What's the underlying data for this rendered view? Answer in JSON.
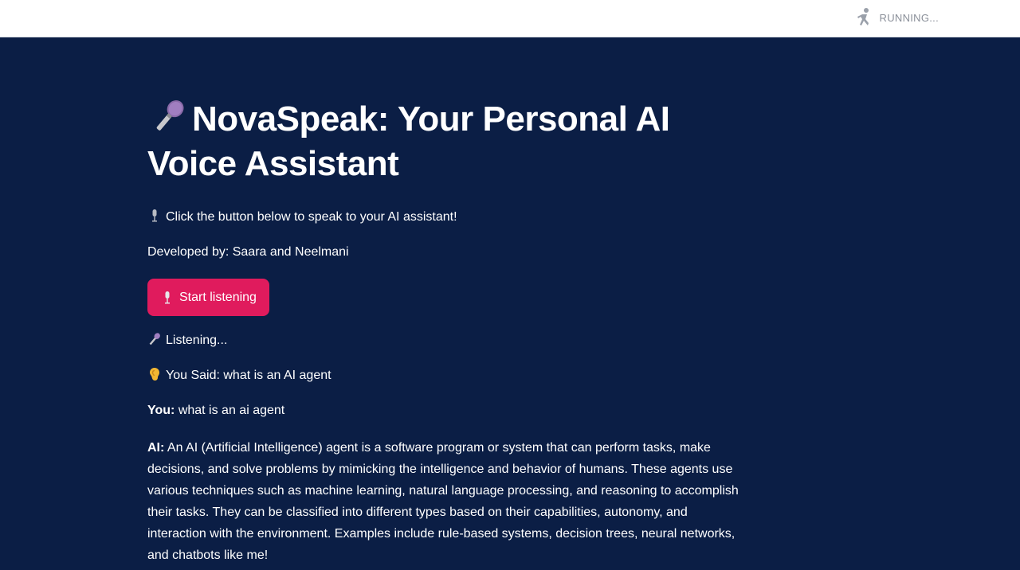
{
  "header": {
    "status_text": "RUNNING...",
    "status_icon": "running-person-icon"
  },
  "app": {
    "title_icon": "microphone-icon",
    "title": "NovaSpeak: Your Personal AI Voice Assistant",
    "instruction_icon": "studio-microphone-icon",
    "instruction": "Click the button below to speak to your AI assistant!",
    "developer": "Developed by: Saara and Neelmani",
    "button": {
      "icon": "studio-microphone-icon",
      "label": "Start listening",
      "color": "#e01b5d"
    },
    "listening_icon": "microphone-icon",
    "listening": "Listening...",
    "you_said_icon": "ear-icon",
    "you_said": "You Said: what is an AI agent",
    "you_label": "You:",
    "you_text": "what is an ai agent",
    "ai_label": "AI:",
    "ai_text": "An AI (Artificial Intelligence) agent is a software program or system that can perform tasks, make decisions, and solve problems by mimicking the intelligence and behavior of humans. These agents use various techniques such as machine learning, natural language processing, and reasoning to accomplish their tasks. They can be classified into different types based on their capabilities, autonomy, and interaction with the environment. Examples include rule-based systems, decision trees, neural networks, and chatbots like me!"
  },
  "colors": {
    "background": "#0b1e45",
    "accent": "#e01b5d",
    "header_bg": "#ffffff",
    "status_text": "#8a8f99"
  }
}
